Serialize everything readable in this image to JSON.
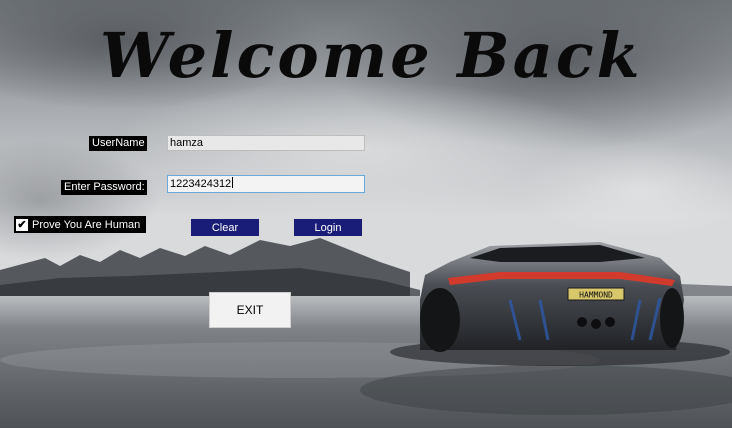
{
  "window": {
    "title": "Welcome Back"
  },
  "form": {
    "username_label": "UserName",
    "username_value": "hamza",
    "password_label": "Enter Password:",
    "password_value": "1223424312",
    "human_check_label": "Prove You Are Human",
    "human_check_checked": true,
    "human_check_mark": "✔",
    "clear_label": "Clear",
    "login_label": "Login",
    "exit_label": "EXIT"
  },
  "background": {
    "plate_text": "HAMMOND",
    "sky_color": "#8d9297",
    "ground_color": "#5d6166",
    "car_color": "#3a3d42",
    "taillight_color": "#d23a2c"
  },
  "colors": {
    "button_navy": "#1a1d78",
    "label_bg": "#000000",
    "focus_border": "#6aa8d8"
  }
}
